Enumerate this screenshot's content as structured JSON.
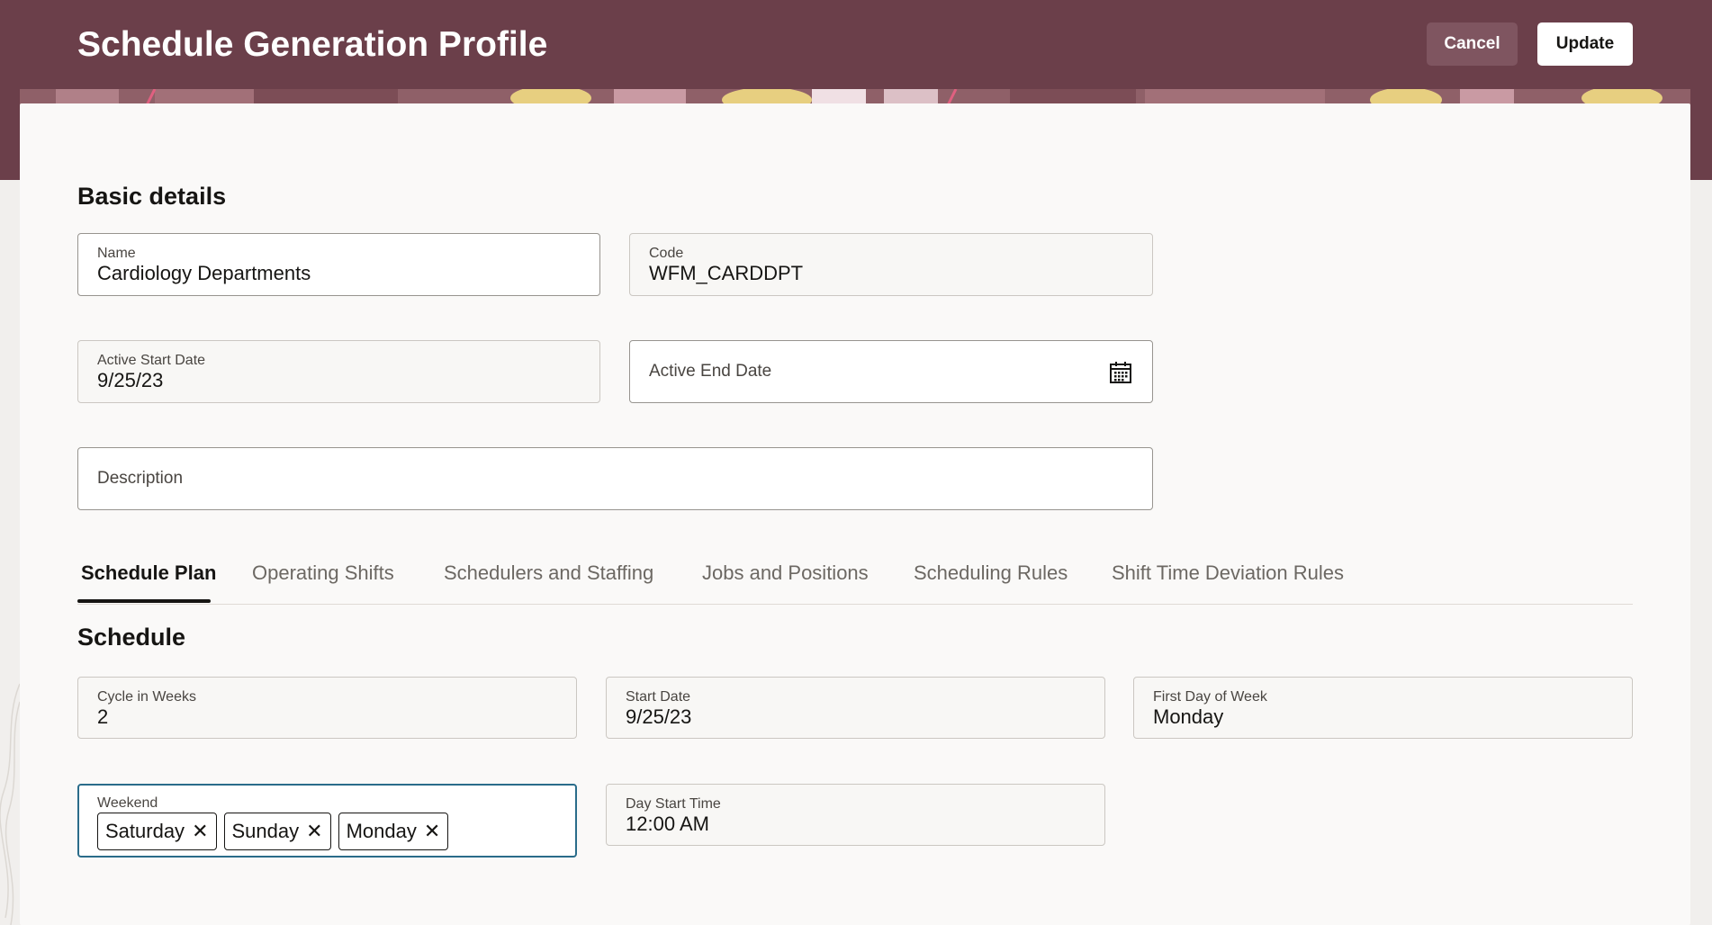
{
  "header": {
    "title": "Schedule Generation Profile",
    "cancel_label": "Cancel",
    "update_label": "Update"
  },
  "basic": {
    "section_title": "Basic details",
    "name": {
      "label": "Name",
      "value": "Cardiology Departments"
    },
    "code": {
      "label": "Code",
      "value": "WFM_CARDDPT"
    },
    "active_start": {
      "label": "Active Start Date",
      "value": "9/25/23"
    },
    "active_end": {
      "label": "Active End Date",
      "value": ""
    },
    "description": {
      "label": "Description",
      "value": ""
    }
  },
  "tabs": [
    {
      "label": "Schedule Plan",
      "active": true
    },
    {
      "label": "Operating Shifts"
    },
    {
      "label": "Schedulers and Staffing"
    },
    {
      "label": "Jobs and Positions"
    },
    {
      "label": "Scheduling Rules"
    },
    {
      "label": "Shift Time Deviation Rules"
    }
  ],
  "schedule": {
    "section_title": "Schedule",
    "cycle": {
      "label": "Cycle in Weeks",
      "value": "2"
    },
    "start_date": {
      "label": "Start Date",
      "value": "9/25/23"
    },
    "first_day": {
      "label": "First Day of Week",
      "value": "Monday"
    },
    "weekend": {
      "label": "Weekend",
      "chips": [
        "Saturday",
        "Sunday",
        "Monday"
      ]
    },
    "day_start": {
      "label": "Day Start Time",
      "value": "12:00 AM"
    }
  },
  "icons": {
    "remove": "close-icon",
    "date": "calendar-icon"
  },
  "colors": {
    "header": "#6b3f4a",
    "focus_border": "#2a6c8a",
    "card": "#faf9f8"
  }
}
